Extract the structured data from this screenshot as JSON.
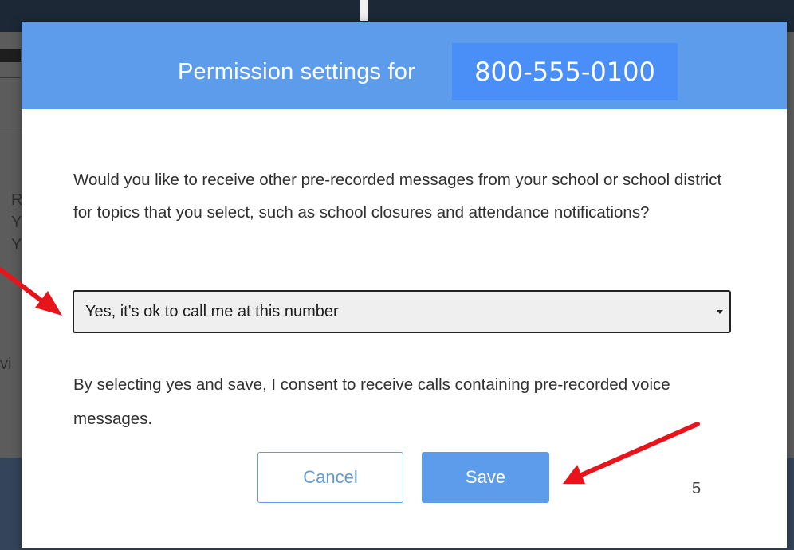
{
  "background": {
    "fragments": [
      "R",
      "Y",
      "Y",
      "vi"
    ]
  },
  "modal": {
    "title_prefix": "Permission settings for",
    "phone_number": "800-555-0100",
    "question": "Would you like to receive other pre-recorded messages from your school or school district for topics that you select, such as school closures and attendance notifications?",
    "select": {
      "selected_value": "Yes, it's ok to call me at this number"
    },
    "consent_text": "By selecting yes and save, I consent to receive calls containing pre-recorded voice messages.",
    "buttons": {
      "cancel_label": "Cancel",
      "save_label": "Save"
    },
    "slide_number": "5"
  },
  "colors": {
    "header": "#5c9cea",
    "phone_box": "#4a8ef7",
    "annotation_arrow": "#e8141b"
  },
  "icons": {
    "select_caret": "caret-down-icon",
    "annotation": "red-arrow-icon"
  }
}
